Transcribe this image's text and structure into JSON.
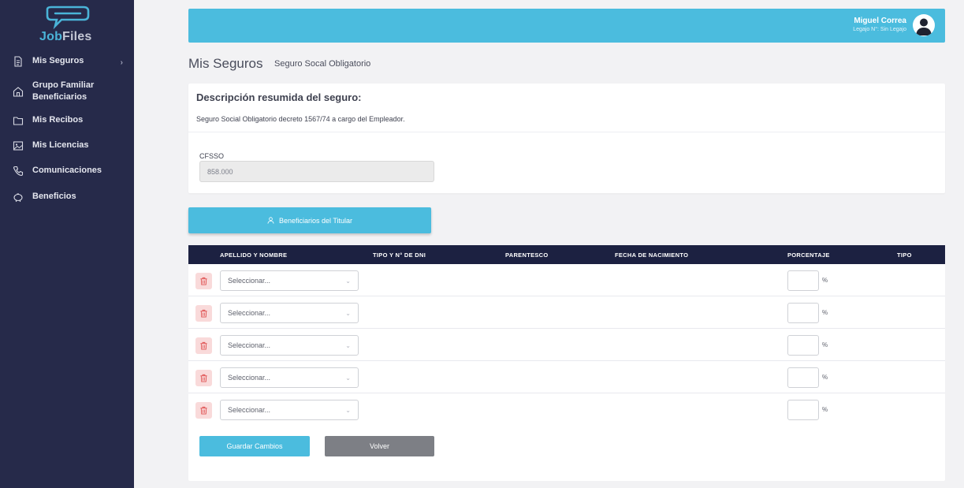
{
  "brand": {
    "part1": "Job",
    "part2": "Files"
  },
  "sidebar": {
    "items": [
      {
        "label": "Mis Seguros",
        "icon": "document-icon",
        "has_submenu": true
      },
      {
        "label": "Grupo Familiar Beneficiarios",
        "icon": "home-icon"
      },
      {
        "label": "Mis Recibos",
        "icon": "folder-icon"
      },
      {
        "label": "Mis Licencias",
        "icon": "image-icon"
      },
      {
        "label": "Comunicaciones",
        "icon": "phone-icon"
      },
      {
        "label": "Beneficios",
        "icon": "piggy-bank-icon"
      }
    ]
  },
  "header": {
    "user_name": "Miguel Correa",
    "user_sub": "Legajo N°: Sin Legajo"
  },
  "page": {
    "title": "Mis Seguros",
    "subtitle": "Seguro Socal Obligatorio"
  },
  "description": {
    "title": "Descripción resumida del seguro:",
    "text": "Seguro Social Obligatorio decreto 1567/74 a cargo del Empleador.",
    "field_label": "CFSSO",
    "field_value": "858.000"
  },
  "beneficiaries_button": "Beneficiarios del Titular",
  "table": {
    "headers": [
      "APELLIDO Y NOMBRE",
      "TIPO Y N° DE DNI",
      "PARENTESCO",
      "FECHA DE NACIMIENTO",
      "PORCENTAJE",
      "TIPO"
    ],
    "rows": [
      {
        "select": "Seleccionar...",
        "pct": "",
        "pct_sign": "%"
      },
      {
        "select": "Seleccionar...",
        "pct": "",
        "pct_sign": "%"
      },
      {
        "select": "Seleccionar...",
        "pct": "",
        "pct_sign": "%"
      },
      {
        "select": "Seleccionar...",
        "pct": "",
        "pct_sign": "%"
      },
      {
        "select": "Seleccionar...",
        "pct": "",
        "pct_sign": "%"
      }
    ]
  },
  "actions": {
    "save": "Guardar Cambios",
    "back": "Volver"
  },
  "colors": {
    "sidebar": "#262a4a",
    "accent": "#4bbcde",
    "table_header": "#1c2141",
    "danger": "#e05252"
  }
}
